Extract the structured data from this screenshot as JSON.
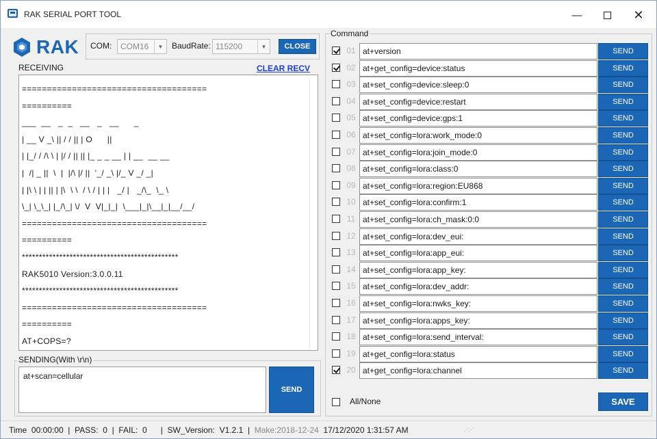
{
  "window": {
    "title": "RAK SERIAL PORT TOOL",
    "controls": {
      "minimize": "—",
      "close": "✕"
    }
  },
  "logo": {
    "text": "RAK"
  },
  "port": {
    "com_label": "COM:",
    "com_value": "COM16",
    "baud_label": "BaudRate:",
    "baud_value": "115200",
    "close_button": "CLOSE"
  },
  "receiving": {
    "label": "RECEIVING",
    "clear_button": "CLEAR RECV",
    "lines": [
      "=====================================",
      "==========",
      "___  __   _  _   __   _   __      _",
      "| __ V _\\ || / / || | O      ||",
      "| |_/ / /\\ \\ | |/ / || || |_ _ _ __ | | __  __ __",
      "|  /| _ ||  \\  |  |/\\ |/ ||  '_/ _\\ |/_ V _/ _|",
      "| |\\ \\ | | || | |\\  \\ \\  / \\ / | | |   _/ |   _/\\_  \\_ \\",
      "\\_| \\_\\_| |_/\\_| \\/  V  V|_|_|  \\___|_|\\__|_|__/__/",
      "=====================================",
      "==========",
      "**********************************************",
      "RAK5010 Version:3.0.0.11",
      "**********************************************",
      "=====================================",
      "==========",
      "AT+COPS=?"
    ]
  },
  "sending": {
    "label": "SENDING(With \\r\\n)",
    "value": "at+scan=cellular",
    "send_button": "SEND"
  },
  "command": {
    "label": "Command",
    "send_label": "SEND",
    "rows": [
      {
        "index": "01",
        "checked": true,
        "text": "at+version"
      },
      {
        "index": "02",
        "checked": true,
        "text": "at+get_config=device:status"
      },
      {
        "index": "03",
        "checked": false,
        "text": "at+set_config=device:sleep:0"
      },
      {
        "index": "04",
        "checked": false,
        "text": "at+set_config=device:restart"
      },
      {
        "index": "05",
        "checked": false,
        "text": "at+set_config=device:gps:1"
      },
      {
        "index": "06",
        "checked": false,
        "text": "at+set_config=lora:work_mode:0"
      },
      {
        "index": "07",
        "checked": false,
        "text": "at+set_config=lora:join_mode:0"
      },
      {
        "index": "08",
        "checked": false,
        "text": "at+set_config=lora:class:0"
      },
      {
        "index": "09",
        "checked": false,
        "text": "at+set_config=lora:region:EU868"
      },
      {
        "index": "10",
        "checked": false,
        "text": "at+set_config=lora:confirm:1"
      },
      {
        "index": "11",
        "checked": false,
        "text": "at+set_config=lora:ch_mask:0:0"
      },
      {
        "index": "12",
        "checked": false,
        "text": "at+set_config=lora:dev_eui:"
      },
      {
        "index": "13",
        "checked": false,
        "text": "at+set_config=lora:app_eui:"
      },
      {
        "index": "14",
        "checked": false,
        "text": "at+set_config=lora:app_key:"
      },
      {
        "index": "15",
        "checked": false,
        "text": "at+set_config=lora:dev_addr:"
      },
      {
        "index": "16",
        "checked": false,
        "text": "at+set_config=lora:nwks_key:"
      },
      {
        "index": "17",
        "checked": false,
        "text": "at+set_config=lora:apps_key:"
      },
      {
        "index": "18",
        "checked": false,
        "text": "at+set_config=lora:send_interval:"
      },
      {
        "index": "19",
        "checked": false,
        "text": "at+get_config=lora:status"
      },
      {
        "index": "20",
        "checked": true,
        "text": "at+get_config=lora:channel"
      }
    ],
    "all_none_label": "All/None",
    "save_button": "SAVE"
  },
  "status": {
    "time_label": "Time",
    "time_value": "00:00:00",
    "pass_label": "PASS:",
    "pass_value": "0",
    "fail_label": "FAIL:",
    "fail_value": "0",
    "version_label": "SW_Version:",
    "version_value": "V1.2.1",
    "make": "Make:2018-12-24",
    "datetime": "17/12/2020 1:31:57 AM"
  },
  "colors": {
    "accent": "#1b67b5",
    "link": "#1b3fd0"
  }
}
